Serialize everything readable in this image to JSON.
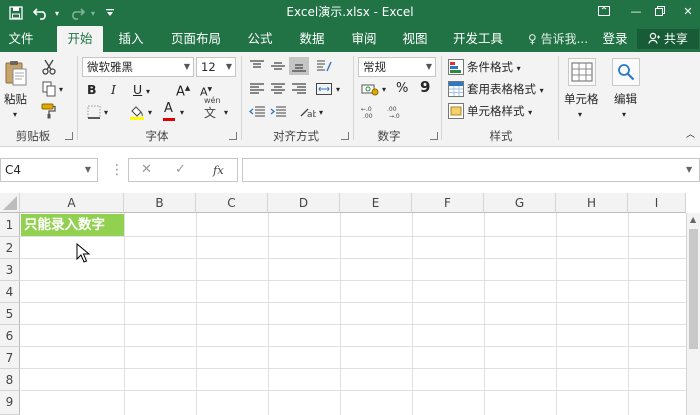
{
  "window": {
    "title": "Excel演示.xlsx - Excel",
    "minimize_glyph": "—",
    "close_glyph": "✕"
  },
  "menu_tabs": [
    {
      "label": "文件"
    },
    {
      "label": "开始"
    },
    {
      "label": "插入"
    },
    {
      "label": "页面布局"
    },
    {
      "label": "公式"
    },
    {
      "label": "数据"
    },
    {
      "label": "审阅"
    },
    {
      "label": "视图"
    },
    {
      "label": "开发工具"
    }
  ],
  "tell_me": "♀ 告诉我...",
  "sign_in": "登录",
  "share": "共享",
  "ribbon": {
    "groups": {
      "clipboard": "剪贴板",
      "font": "字体",
      "alignment": "对齐方式",
      "number": "数字",
      "styles": "样式"
    },
    "paste_label": "粘贴",
    "font_name": "微软雅黑",
    "font_size": "12",
    "bold": "B",
    "italic": "I",
    "underline": "U",
    "number_format": "常规",
    "conditional_format": "条件格式",
    "table_format": "套用表格格式",
    "cell_styles": "单元格样式",
    "cells_label": "单元格",
    "edit_label": "编辑",
    "percent": "%",
    "comma": "9",
    "grow_font": "A",
    "shrink_font": "A",
    "font_color": "A",
    "wen": "wén",
    "wen_char": "文"
  },
  "formula_bar": {
    "name_box": "C4",
    "fx": "fx",
    "cancel": "✕",
    "enter": "✓",
    "value": ""
  },
  "sheet": {
    "columns": [
      "A",
      "B",
      "C",
      "D",
      "E",
      "F",
      "G",
      "H",
      "I"
    ],
    "rows": [
      "1",
      "2",
      "3",
      "4",
      "5",
      "6",
      "7",
      "8",
      "9"
    ],
    "cell_a1": "只能录入数字"
  },
  "colors": {
    "excel_green": "#217346",
    "highlight_green": "#92d050"
  }
}
